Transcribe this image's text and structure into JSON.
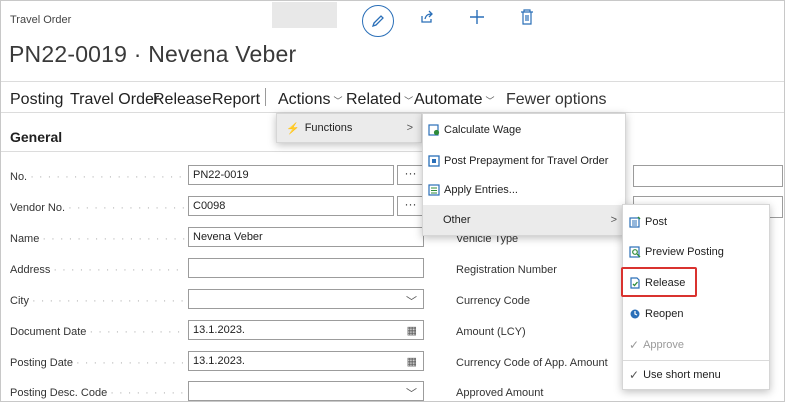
{
  "page": {
    "type": "Travel Order",
    "title": "PN22-0019 · Nevena Veber"
  },
  "toolbar_icons": [
    "edit-icon",
    "share-icon",
    "new-icon",
    "delete-icon"
  ],
  "action_bar": {
    "posting": "Posting",
    "travel_order": "Travel Order",
    "release": "Release",
    "report": "Report",
    "actions": "Actions",
    "related": "Related",
    "automate": "Automate",
    "fewer": "Fewer options"
  },
  "section": {
    "title": "General"
  },
  "fields": [
    {
      "label": "No.",
      "value": "PN22-0019"
    },
    {
      "label": "Vendor No.",
      "value": "C0098"
    },
    {
      "label": "Name",
      "value": "Nevena Veber"
    },
    {
      "label": "Address",
      "value": ""
    },
    {
      "label": "City",
      "value": ""
    },
    {
      "label": "Document Date",
      "value": "13.1.2023."
    },
    {
      "label": "Posting Date",
      "value": "13.1.2023."
    },
    {
      "label": "Posting Desc. Code",
      "value": ""
    }
  ],
  "right_fields": [
    {
      "label": "Vehicle Type"
    },
    {
      "label": "Registration Number"
    },
    {
      "label": "Currency Code"
    },
    {
      "label": "Amount (LCY)"
    },
    {
      "label": "Currency Code of App. Amount"
    },
    {
      "label": "Approved Amount"
    }
  ],
  "actions_menu": {
    "functions": "Functions"
  },
  "functions_menu": {
    "calculate_wage": "Calculate Wage",
    "post_prepayment": "Post Prepayment for Travel Order",
    "apply_entries": "Apply Entries...",
    "other": "Other"
  },
  "other_menu": {
    "post": "Post",
    "preview_posting": "Preview Posting",
    "release": "Release",
    "reopen": "Reopen",
    "approve": "Approve",
    "use_short_menu": "Use short menu"
  },
  "colors": {
    "accent": "#2a6fb8",
    "highlight_border": "#d9322f",
    "selected_bg": "#ebebeb"
  }
}
